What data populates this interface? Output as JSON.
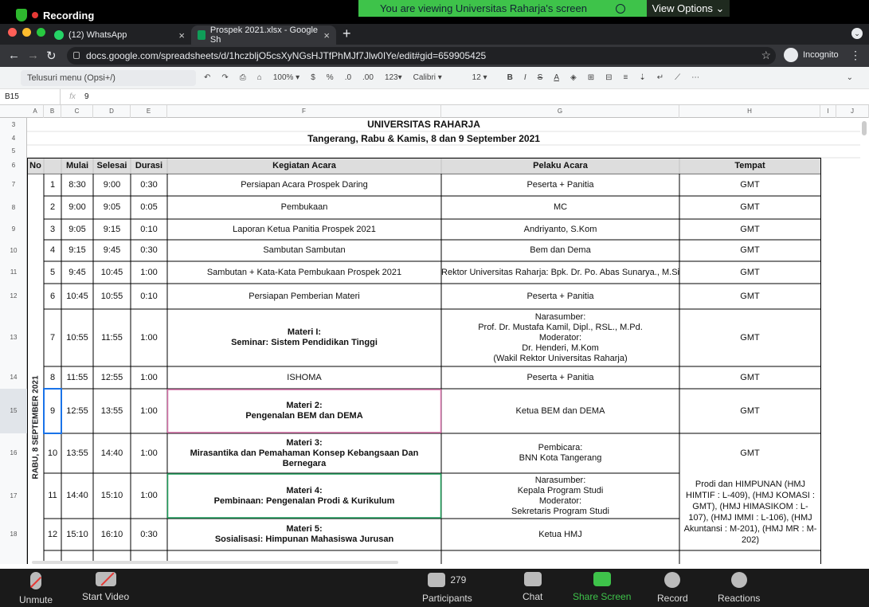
{
  "zoom_top": {
    "recording_label": "Recording",
    "viewing_text": "You are viewing Universitas Raharja's screen",
    "view_options": "View Options"
  },
  "browser": {
    "tab1": "(12) WhatsApp",
    "tab2": "Prospek 2021.xlsx - Google Sh",
    "url": "docs.google.com/spreadsheets/d/1hczbljO5csXyNGsHJTfPhMJf7Jlw0IYe/edit#gid=659905425",
    "profile": "Incognito"
  },
  "sheets": {
    "menu_search": "Telusuri menu (Opsi+/)",
    "zoom": "100%",
    "currency": "$",
    "percent": "%",
    "dec_less": ".0",
    "dec_more": ".00",
    "number_format": "123",
    "font": "Calibri",
    "font_size": "12",
    "cell_ref": "B15",
    "formula_value": "9",
    "columns": [
      "A",
      "B",
      "C",
      "D",
      "E",
      "F",
      "G",
      "H",
      "I",
      "J"
    ],
    "rows": [
      "3",
      "4",
      "5",
      "6",
      "7",
      "8",
      "9",
      "10",
      "11",
      "12",
      "13",
      "14",
      "15",
      "16",
      "17",
      "18"
    ]
  },
  "schedule": {
    "title": "UNIVERSITAS RAHARJA",
    "subtitle": "Tangerang, Rabu & Kamis, 8 dan 9 September 2021",
    "day_label": "RABU, 8 SEPTEMBER 2021",
    "headers": [
      "No",
      "Mulai",
      "Selesai",
      "Durasi",
      "Kegiatan Acara",
      "Pelaku Acara",
      "Tempat"
    ],
    "rows": [
      {
        "no": "1",
        "mulai": "8:30",
        "selesai": "9:00",
        "durasi": "0:30",
        "kegiatan": "Persiapan Acara Prospek Daring",
        "pelaku": "Peserta + Panitia",
        "tempat": "GMT"
      },
      {
        "no": "2",
        "mulai": "9:00",
        "selesai": "9:05",
        "durasi": "0:05",
        "kegiatan": "Pembukaan",
        "pelaku": "MC",
        "tempat": "GMT"
      },
      {
        "no": "3",
        "mulai": "9:05",
        "selesai": "9:15",
        "durasi": "0:10",
        "kegiatan": "Laporan Ketua Panitia Prospek 2021",
        "pelaku": "Andriyanto, S.Kom",
        "tempat": "GMT"
      },
      {
        "no": "4",
        "mulai": "9:15",
        "selesai": "9:45",
        "durasi": "0:30",
        "kegiatan": "Sambutan Sambutan",
        "pelaku": "Bem dan Dema",
        "tempat": "GMT"
      },
      {
        "no": "5",
        "mulai": "9:45",
        "selesai": "10:45",
        "durasi": "1:00",
        "kegiatan": "Sambutan + Kata-Kata Pembukaan Prospek 2021",
        "pelaku": "Rektor Universitas Raharja: Bpk. Dr. Po. Abas Sunarya., M.Si",
        "tempat": "GMT"
      },
      {
        "no": "6",
        "mulai": "10:45",
        "selesai": "10:55",
        "durasi": "0:10",
        "kegiatan": "Persiapan Pemberian Materi",
        "pelaku": "Peserta + Panitia",
        "tempat": "GMT"
      },
      {
        "no": "7",
        "mulai": "10:55",
        "selesai": "11:55",
        "durasi": "1:00",
        "kegiatan_title": "Materi I:",
        "kegiatan": "Seminar: Sistem Pendidikan Tinggi",
        "pelaku_lines": [
          "Narasumber:",
          "Prof. Dr. Mustafa Kamil, Dipl., RSL., M.Pd.",
          "Moderator:",
          "Dr. Henderi, M.Kom",
          "(Wakil Rektor Universitas Raharja)"
        ],
        "tempat": "GMT"
      },
      {
        "no": "8",
        "mulai": "11:55",
        "selesai": "12:55",
        "durasi": "1:00",
        "kegiatan": "ISHOMA",
        "pelaku": "Peserta + Panitia",
        "tempat": "GMT"
      },
      {
        "no": "9",
        "mulai": "12:55",
        "selesai": "13:55",
        "durasi": "1:00",
        "kegiatan_title": "Materi 2:",
        "kegiatan": "Pengenalan BEM dan DEMA",
        "pelaku": "Ketua BEM dan DEMA",
        "tempat": "GMT"
      },
      {
        "no": "10",
        "mulai": "13:55",
        "selesai": "14:40",
        "durasi": "1:00",
        "kegiatan_title": "Materi 3:",
        "kegiatan": "Mirasantika dan Pemahaman Konsep Kebangsaan Dan Bernegara",
        "pelaku_lines": [
          "Pembicara:",
          "BNN Kota Tangerang"
        ],
        "tempat": "GMT"
      },
      {
        "no": "11",
        "mulai": "14:40",
        "selesai": "15:10",
        "durasi": "1:00",
        "kegiatan_title": "Materi 4:",
        "kegiatan": "Pembinaan: Pengenalan Prodi & Kurikulum",
        "pelaku_lines": [
          "Narasumber:",
          "Kepala Program Studi",
          "Moderator:",
          "Sekretaris Program Studi"
        ]
      },
      {
        "no": "12",
        "mulai": "15:10",
        "selesai": "16:10",
        "durasi": "0:30",
        "kegiatan_title": "Materi 5:",
        "kegiatan": "Sosialisasi: Himpunan Mahasiswa Jurusan",
        "pelaku": "Ketua HMJ"
      }
    ],
    "tempat_merged": "Prodi dan HIMPUNAN (HMJ HIMTIF : L-409), (HMJ KOMASI : GMT), (HMJ HIMASIKOM : L-107), (HMJ IMMI : L-106), (HMJ Akuntansi : M-201), (HMJ MR : M-202)"
  },
  "zoom_bottom": {
    "unmute": "Unmute",
    "start_video": "Start Video",
    "participants": "Participants",
    "participants_count": "279",
    "chat": "Chat",
    "share_screen": "Share Screen",
    "record": "Record",
    "reactions": "Reactions"
  }
}
